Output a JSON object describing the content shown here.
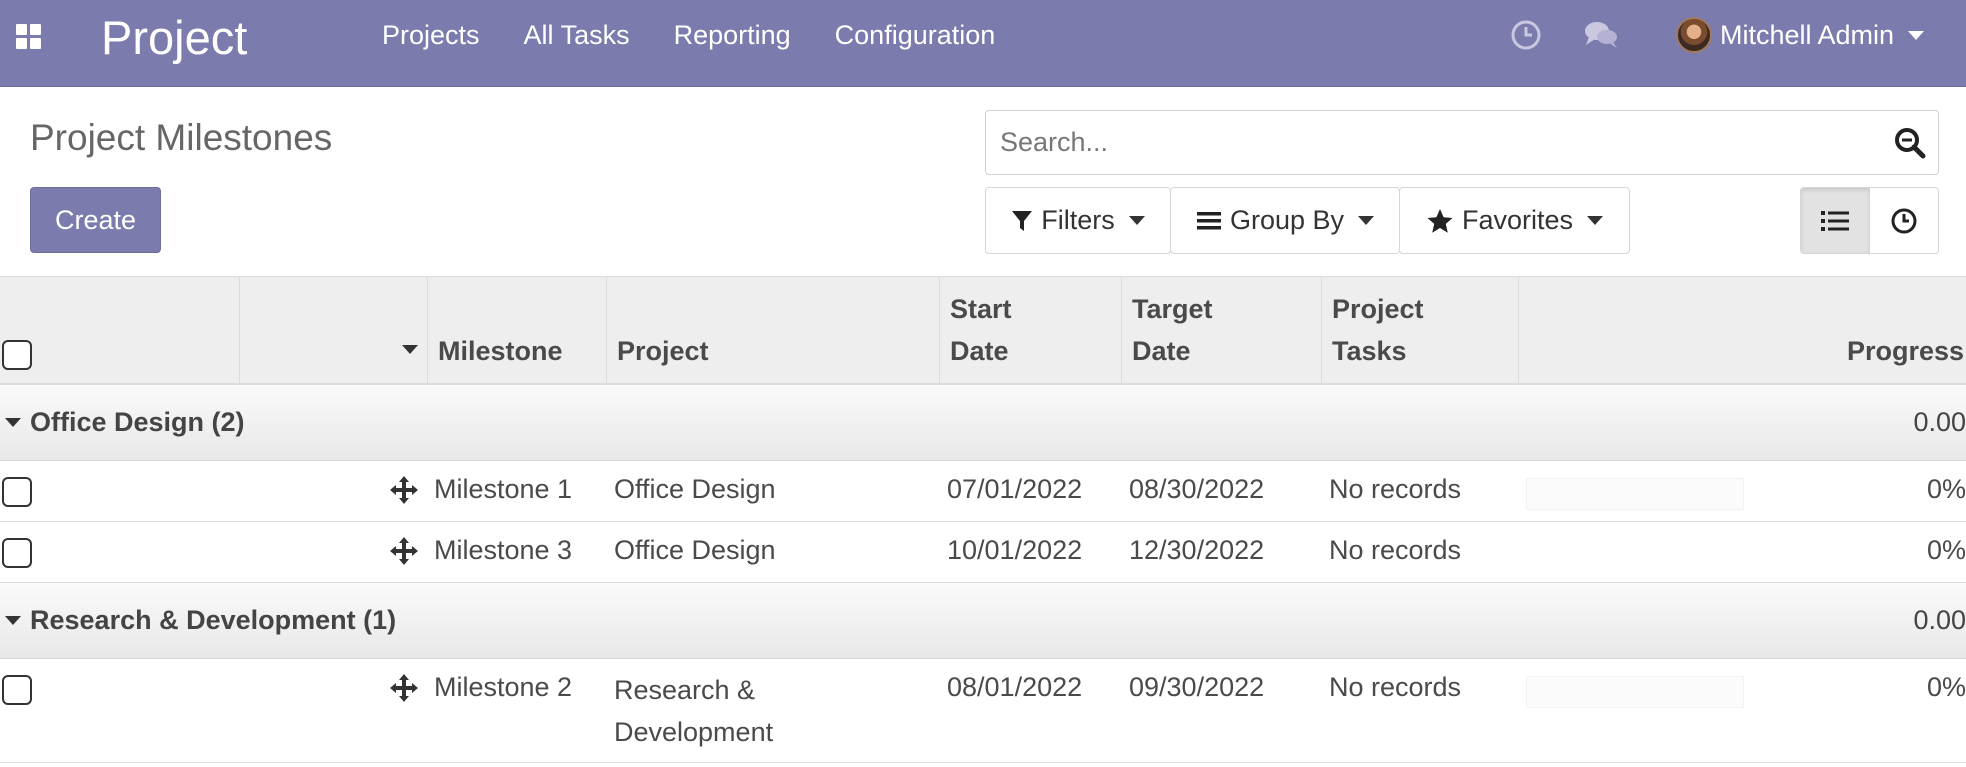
{
  "navbar": {
    "brand": "Project",
    "menu": [
      "Projects",
      "All Tasks",
      "Reporting",
      "Configuration"
    ],
    "user_name": "Mitchell Admin",
    "icons": [
      "apps-grid-icon",
      "clock-icon",
      "chat-icon"
    ]
  },
  "control_panel": {
    "title": "Project Milestones",
    "create_label": "Create",
    "search_placeholder": "Search...",
    "filters_label": "Filters",
    "groupby_label": "Group By",
    "favorites_label": "Favorites"
  },
  "table": {
    "headers": {
      "milestone": "Milestone",
      "project": "Project",
      "start_date": [
        "Start",
        "Date"
      ],
      "target_date": [
        "Target",
        "Date"
      ],
      "project_tasks": [
        "Project",
        "Tasks"
      ],
      "progress": "Progress"
    },
    "groups": [
      {
        "name": "Office Design (2)",
        "aggregate": "0.00",
        "rows": [
          {
            "milestone": "Milestone 1",
            "project": "Office Design",
            "start_date": "07/01/2022",
            "target_date": "08/30/2022",
            "project_tasks": "No records",
            "progress": "0%"
          },
          {
            "milestone": "Milestone 3",
            "project": "Office Design",
            "start_date": "10/01/2022",
            "target_date": "12/30/2022",
            "project_tasks": "No records",
            "progress": "0%"
          }
        ]
      },
      {
        "name": "Research & Development (1)",
        "aggregate": "0.00",
        "rows": [
          {
            "milestone": "Milestone 2",
            "project": "Research & Development",
            "start_date": "08/01/2022",
            "target_date": "09/30/2022",
            "project_tasks": "No records",
            "progress": "0%"
          }
        ]
      }
    ]
  },
  "colors": {
    "navbar": "#7c7bad",
    "primary_button": "#7c7bad"
  }
}
